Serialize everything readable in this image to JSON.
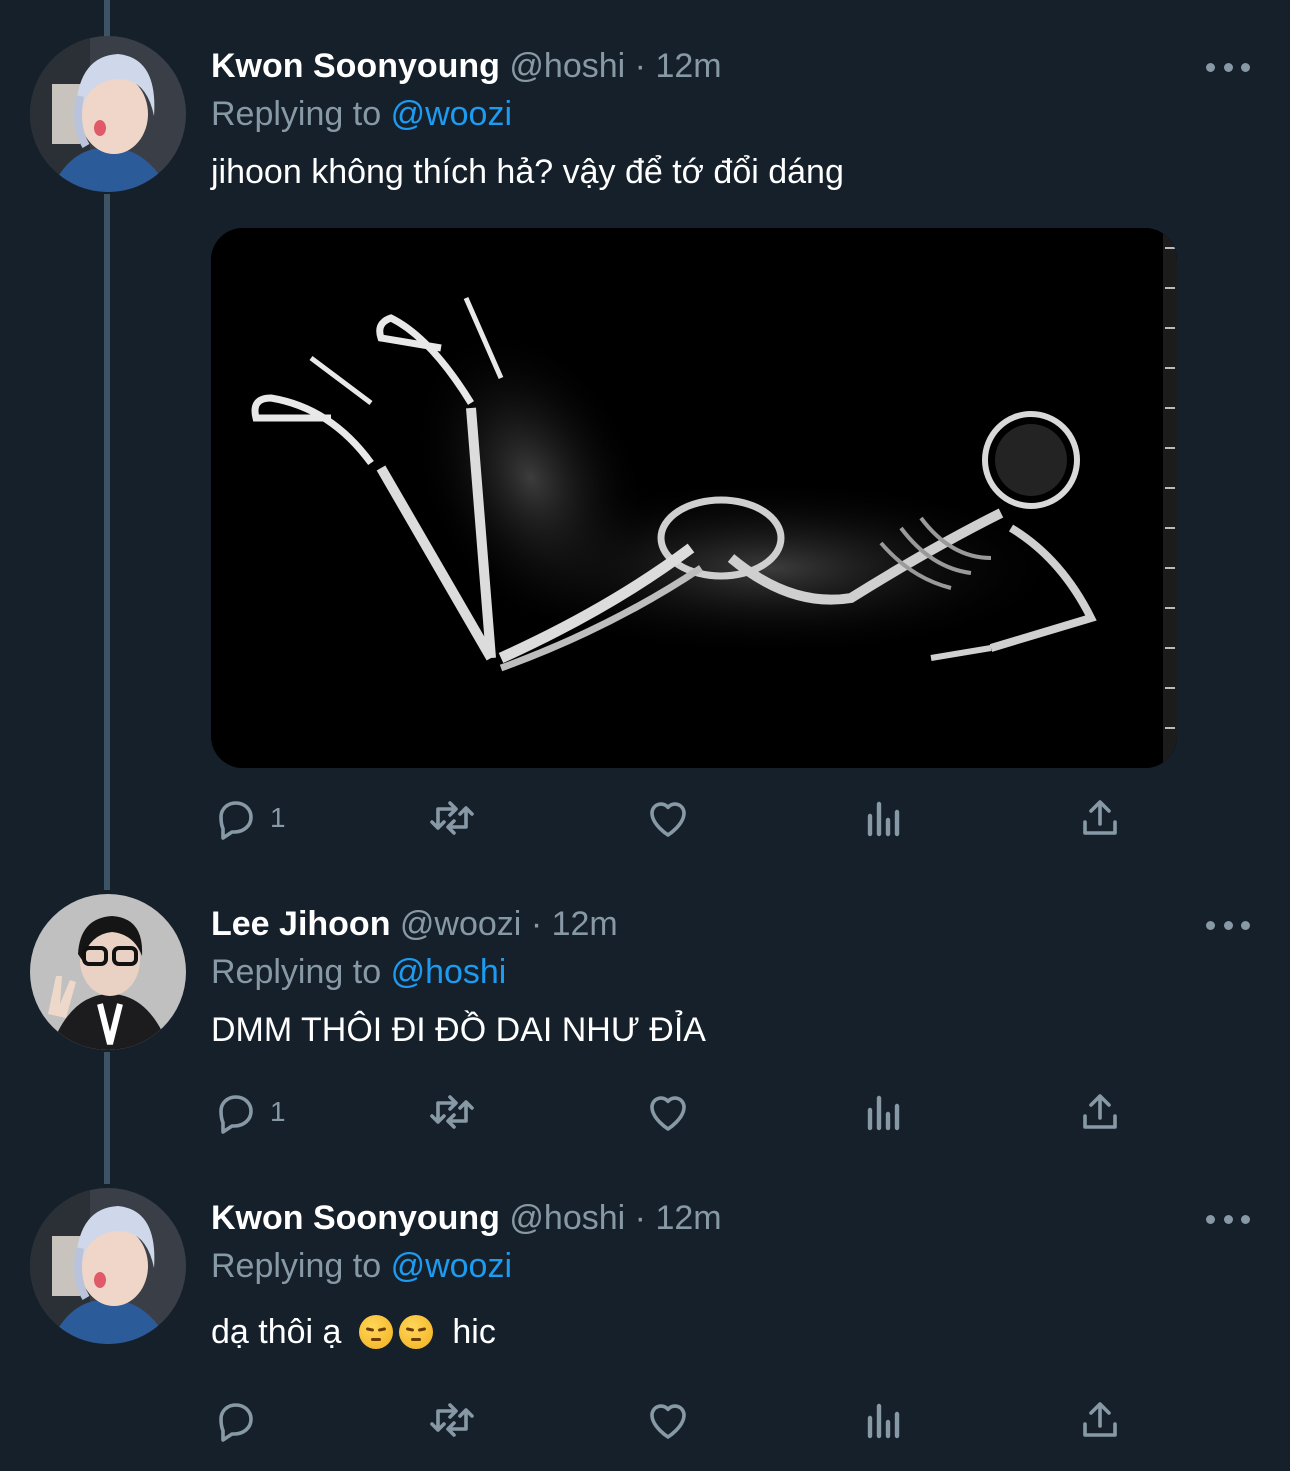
{
  "tweets": [
    {
      "name": "Kwon Soonyoung",
      "handle": "@hoshi",
      "dot": "·",
      "time": "12m",
      "replying_prefix": "Replying to",
      "replying_to": "@woozi",
      "text": "jihoon không thích hả? vậy để tớ đổi dáng",
      "has_media": true,
      "reply_count": "1"
    },
    {
      "name": "Lee Jihoon",
      "handle": "@woozi",
      "dot": "·",
      "time": "12m",
      "replying_prefix": "Replying to",
      "replying_to": "@hoshi",
      "text": "DMM THÔI ĐI ĐỒ DAI NHƯ ĐỈA",
      "has_media": false,
      "reply_count": "1"
    },
    {
      "name": "Kwon Soonyoung",
      "handle": "@hoshi",
      "dot": "·",
      "time": "12m",
      "replying_prefix": "Replying to",
      "replying_to": "@woozi",
      "text_before_emoji": "dạ thôi ạ",
      "text_after_emoji": "hic",
      "emoji": "pensive-face",
      "has_media": false,
      "reply_count": ""
    }
  ],
  "icons": {
    "reply": "reply-icon",
    "retweet": "retweet-icon",
    "like": "heart-icon",
    "analytics": "analytics-icon",
    "share": "share-icon",
    "more": "more-icon"
  },
  "colors": {
    "background": "#15202b",
    "secondary_text": "#8899a6",
    "link": "#1d9bf0",
    "thread_line": "#3d5466"
  }
}
